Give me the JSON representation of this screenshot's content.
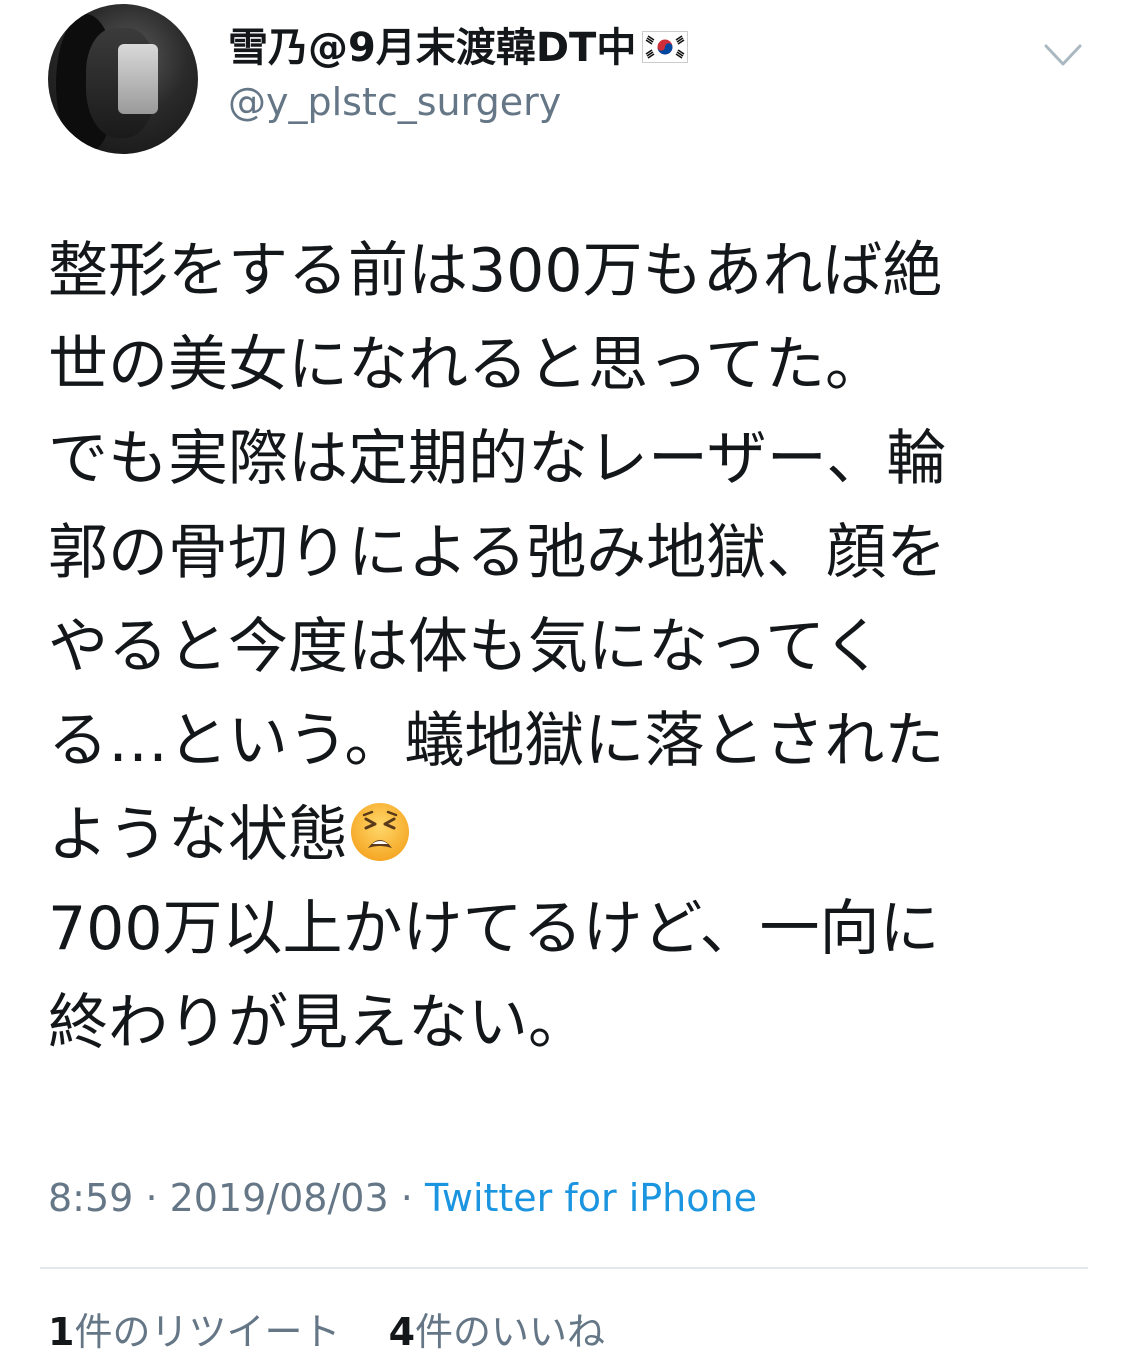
{
  "tweet": {
    "author": {
      "display_name": "雪乃@9月末渡韓DT中",
      "flag_icon": "south-korea-flag-icon",
      "handle": "@y_plstc_surgery",
      "avatar_icon": "user-avatar"
    },
    "menu_icon": "chevron-down-icon",
    "text_lines": [
      "整形をする前は300万もあれば絶",
      "世の美女になれると思ってた。",
      "でも実際は定期的なレーザー、輪",
      "郭の骨切りによる弛み地獄、顔を",
      "やると今度は体も気になってく",
      "る…という。蟻地獄に落とされた",
      "ような状態",
      "700万以上かけてるけど、一向に",
      "終わりが見えない。"
    ],
    "emoji_icon": "tired-face-emoji-icon",
    "time": "8:59",
    "separator": "·",
    "date": "2019/08/03",
    "client": "Twitter for iPhone",
    "retweets": {
      "count": "1",
      "label": "件のリツイート"
    },
    "likes": {
      "count": "4",
      "label": "件のいいね"
    },
    "colors": {
      "text": "#14171a",
      "secondary": "#657786",
      "link": "#1b95e0",
      "divider": "#e1e8ed"
    }
  }
}
